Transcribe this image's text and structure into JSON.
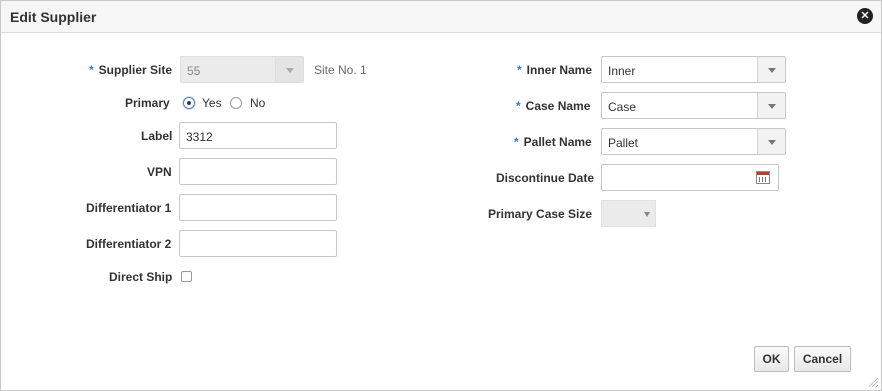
{
  "dialog": {
    "title": "Edit Supplier",
    "close_icon": "close-icon"
  },
  "left": {
    "supplier_site": {
      "label": "Supplier Site",
      "required": "*",
      "value": "55",
      "hint": "Site No. 1"
    },
    "primary": {
      "label": "Primary",
      "options": [
        "Yes",
        "No"
      ],
      "selected": "Yes"
    },
    "label_field": {
      "label": "Label",
      "value": "3312"
    },
    "vpn": {
      "label": "VPN",
      "value": ""
    },
    "diff1": {
      "label": "Differentiator 1",
      "value": ""
    },
    "diff2": {
      "label": "Differentiator 2",
      "value": ""
    },
    "direct_ship": {
      "label": "Direct Ship",
      "checked": false
    }
  },
  "right": {
    "inner_name": {
      "label": "Inner Name",
      "required": "*",
      "value": "Inner"
    },
    "case_name": {
      "label": "Case Name",
      "required": "*",
      "value": "Case"
    },
    "pallet_name": {
      "label": "Pallet Name",
      "required": "*",
      "value": "Pallet"
    },
    "discontinue_date": {
      "label": "Discontinue Date",
      "value": "",
      "icon": "calendar-icon"
    },
    "primary_case_size": {
      "label": "Primary Case Size",
      "value": ""
    }
  },
  "footer": {
    "ok_label": "OK",
    "cancel_label": "Cancel"
  },
  "colors": {
    "required_marker": "#3a79b6",
    "header_bg": "#f6f6f6",
    "disabled_bg": "#ebebeb"
  }
}
